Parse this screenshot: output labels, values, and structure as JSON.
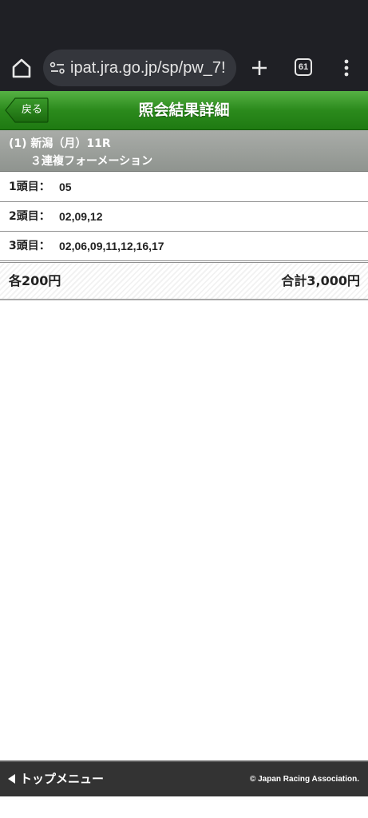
{
  "browser": {
    "url": "ipat.jra.go.jp/sp/pw_7!",
    "tab_count": "61"
  },
  "header": {
    "back_label": "戻る",
    "title": "照会結果詳細"
  },
  "race": {
    "line1": "(1) 新潟（月）11R",
    "line2": "３連複フォーメーション"
  },
  "selections": [
    {
      "label": "1頭目：",
      "value": "05"
    },
    {
      "label": "2頭目：",
      "value": "02,09,12"
    },
    {
      "label": "3頭目：",
      "value": "02,06,09,11,12,16,17"
    }
  ],
  "amount": {
    "unit": "各200円",
    "total": "合計3,000円"
  },
  "footer": {
    "top_menu": "トップメニュー",
    "copyright": "© Japan Racing Association."
  },
  "colors": {
    "header_green": "#2b8a1c",
    "browser_dark": "#1f2025",
    "race_gray": "#9a9e9a",
    "footer_dark": "#333333"
  }
}
